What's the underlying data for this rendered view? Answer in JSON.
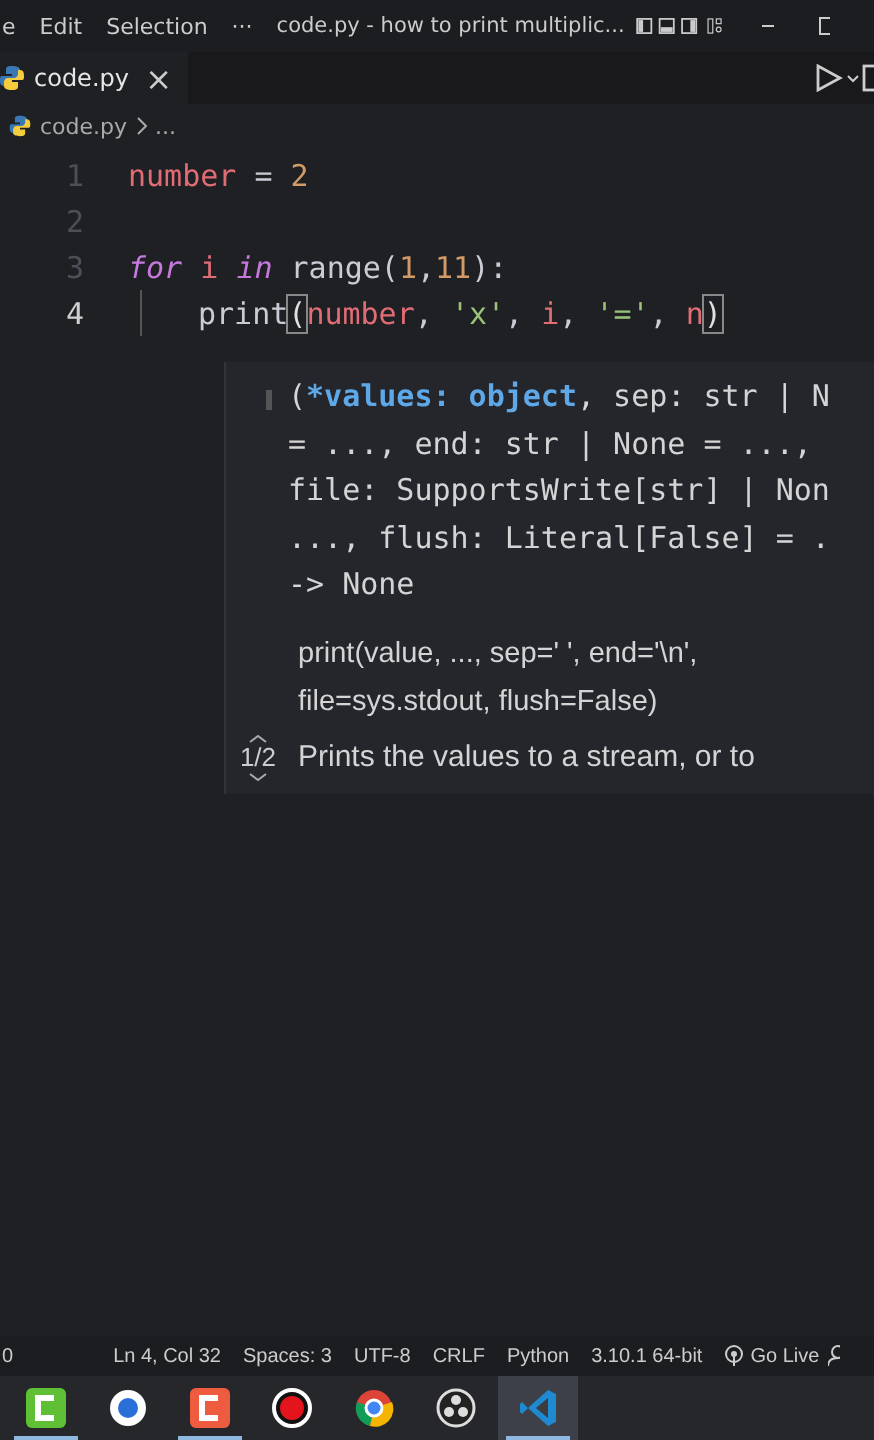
{
  "menu": [
    "e",
    "Edit",
    "Selection",
    "···"
  ],
  "window": {
    "title": "code.py - how to print multiplic..."
  },
  "tabs": [
    {
      "label": "code.py",
      "selected": true,
      "close": "×"
    }
  ],
  "breadcrumb": [
    "code.py",
    "..."
  ],
  "code": [
    {
      "number": "1",
      "active": false,
      "tokens": [
        {
          "text": "number",
          "kind": "var"
        },
        {
          "text": " = ",
          "kind": "op"
        },
        {
          "text": "2",
          "kind": "num"
        }
      ]
    },
    {
      "number": "2",
      "active": false
    },
    {
      "number": "3",
      "active": false,
      "tokens": [
        {
          "text": "for",
          "kind": "kw"
        },
        {
          "text": " i ",
          "kind": "var"
        },
        {
          "text": "in",
          "kind": "kw"
        },
        {
          "text": " range(",
          "kind": "fn"
        },
        {
          "text": "1",
          "kind": "num"
        },
        {
          "text": ",",
          "kind": "op"
        },
        {
          "text": "11",
          "kind": "num"
        },
        {
          "text": "):",
          "kind": "fn"
        }
      ],
      "children": [
        {
          "number": "4",
          "active": true,
          "tokens": [
            {
              "text": "print",
              "kind": "fn"
            },
            {
              "text": "(",
              "kind": "bracket"
            },
            {
              "text": "number",
              "kind": "var"
            },
            {
              "text": ", ",
              "kind": "op"
            },
            {
              "text": "'x'",
              "kind": "str"
            },
            {
              "text": ", ",
              "kind": "op"
            },
            {
              "text": "i",
              "kind": "var"
            },
            {
              "text": ", ",
              "kind": "op"
            },
            {
              "text": "'='",
              "kind": "str"
            },
            {
              "text": ", ",
              "kind": "op"
            },
            {
              "text": "n",
              "kind": "var"
            },
            {
              "text": ")",
              "kind": "bracket"
            }
          ]
        }
      ]
    }
  ],
  "hover": {
    "signature": [
      [
        {
          "text": "(",
          "kind": "plain"
        },
        {
          "text": "*values: object",
          "kind": "param"
        },
        {
          "text": ", sep: str | N",
          "kind": "plain"
        }
      ],
      [
        {
          "text": "= ..., end: str | None = ...,",
          "kind": "plain"
        }
      ],
      [
        {
          "text": "file: SupportsWrite[str] | Non",
          "kind": "plain"
        }
      ],
      [
        {
          "text": "..., flush: Literal[False] = .",
          "kind": "plain"
        }
      ],
      [
        {
          "text": "-> None",
          "kind": "plain"
        }
      ]
    ],
    "doc": [
      "print(value, ..., sep=' ', end='\\n',",
      "file=sys.stdout, flush=False)"
    ],
    "pager": "1/2",
    "description": "Prints the values to a stream, or to"
  },
  "status_bar": [
    "0",
    "Ln 4, Col 32",
    "Spaces: 3",
    "UTF-8",
    "CRLF",
    "Python",
    "3.10.1 64-bit",
    "Go Live"
  ],
  "taskbar": [
    {
      "kind": "green-c",
      "running": true,
      "selected": false
    },
    {
      "kind": "round",
      "running": false,
      "selected": false
    },
    {
      "kind": "red-c",
      "running": true,
      "selected": false
    },
    {
      "kind": "record",
      "running": false,
      "selected": false
    },
    {
      "kind": "browser",
      "running": false,
      "selected": false
    },
    {
      "kind": "aperture",
      "running": false,
      "selected": false
    },
    {
      "kind": "editor",
      "running": true,
      "selected": true
    }
  ]
}
